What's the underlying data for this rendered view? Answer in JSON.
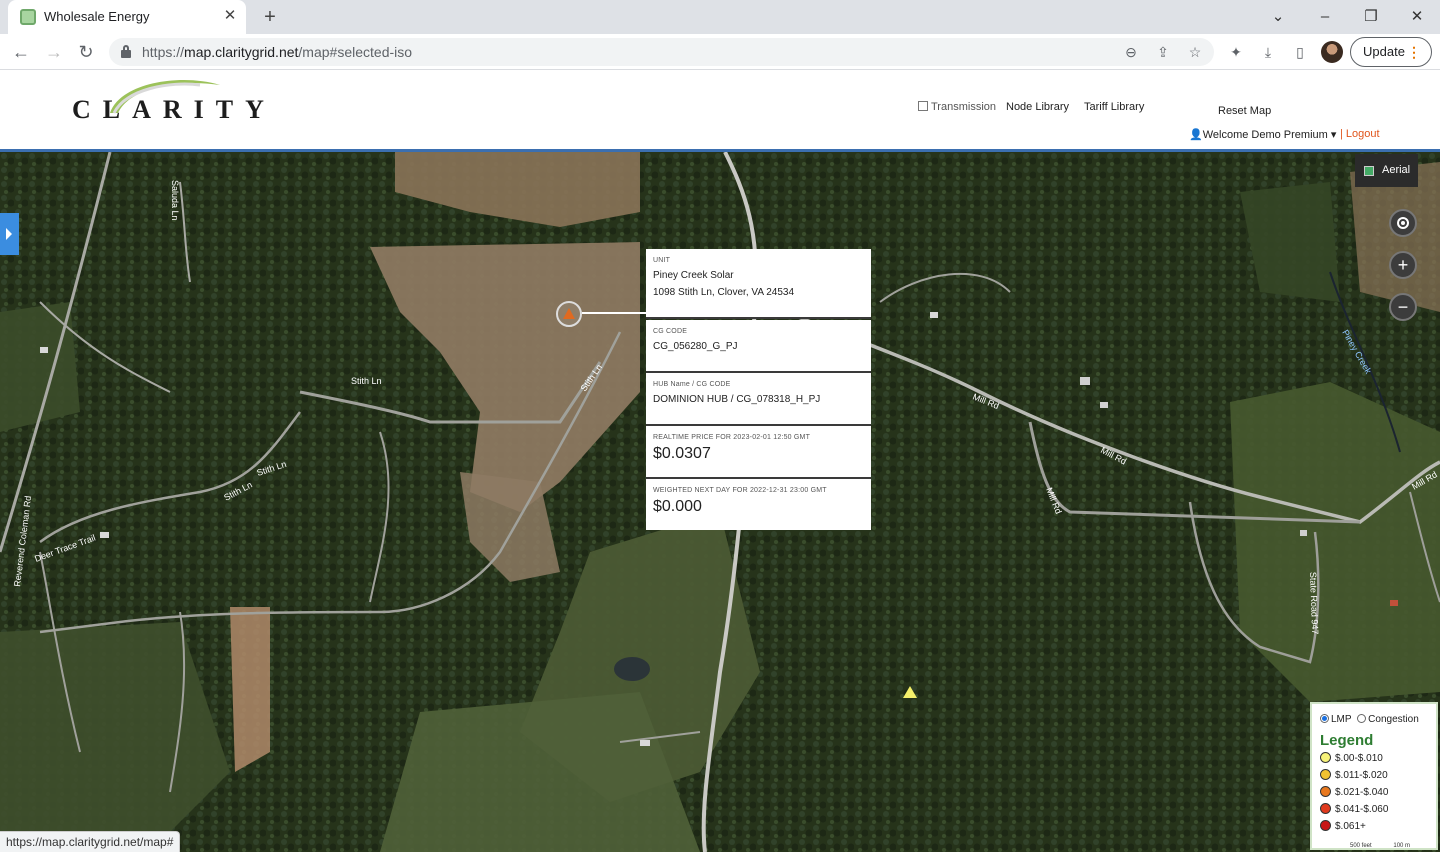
{
  "browser": {
    "tab_title": "Wholesale Energy",
    "url_scheme": "https://",
    "url_host": "map.claritygrid.net",
    "url_path": "/map#selected-iso",
    "update_label": "Update",
    "status_url": "https://map.claritygrid.net/map#"
  },
  "header": {
    "logo_text": "CLARITY",
    "transmission_label": "Transmission",
    "node_library": "Node Library",
    "tariff_library": "Tariff Library",
    "reset_map": "Reset Map",
    "welcome": "Welcome Demo Premium",
    "logout": "| Logout"
  },
  "map": {
    "aerial_label": "Aerial",
    "road_labels": [
      "Saluda Ln",
      "Stith Ln",
      "Stith Ln",
      "Stith Ln",
      "Stith Ln",
      "Reverend Coleman Rd",
      "Deer Trace Trail",
      "Mill Rd",
      "Mill Rd",
      "Mill Rd",
      "Mill Rd",
      "State Road 947"
    ],
    "creek_label": "Piney Creek"
  },
  "popup": {
    "unit_label": "UNIT",
    "unit_name": "Piney Creek Solar",
    "unit_address": "1098 Stith Ln, Clover, VA 24534",
    "cg_label": "CG CODE",
    "cg_code": "CG_056280_G_PJ",
    "hub_label": "HUB Name / CG CODE",
    "hub_value": "DOMINION HUB / CG_078318_H_PJ",
    "rt_label": "REALTIME PRICE FOR 2023-02-01 12:50 GMT",
    "rt_price": "$0.0307",
    "nd_label": "WEIGHTED NEXT DAY FOR 2022-12-31 23:00 GMT",
    "nd_price": "$0.000"
  },
  "legend": {
    "mode_lmp": "LMP",
    "mode_congestion": "Congestion",
    "selected_mode": "LMP",
    "title": "Legend",
    "items": [
      {
        "label": "$.00-$.010",
        "color": "#f7f27a"
      },
      {
        "label": "$.011-$.020",
        "color": "#f2c230"
      },
      {
        "label": "$.021-$.040",
        "color": "#e8781e"
      },
      {
        "label": "$.041-$.060",
        "color": "#e03a1e"
      },
      {
        "label": "$.061+",
        "color": "#c81616"
      }
    ],
    "scale_feet": "500 feet",
    "scale_m": "100 m"
  }
}
